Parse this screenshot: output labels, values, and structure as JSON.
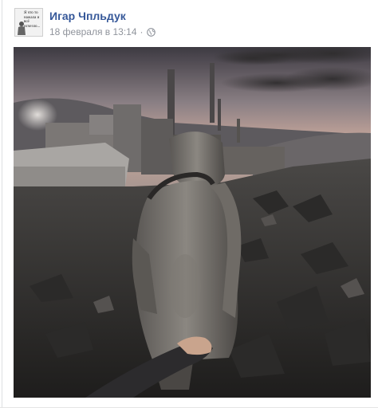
{
  "post": {
    "author": "Игар Чпльдук",
    "timestamp": "18 февраля в 13:14",
    "separator": "·",
    "privacy_icon": "globe-icon",
    "avatar_text": "Я что то нажала и всё исчезло..."
  },
  "colors": {
    "author_link": "#365899",
    "meta_text": "#90949c"
  }
}
